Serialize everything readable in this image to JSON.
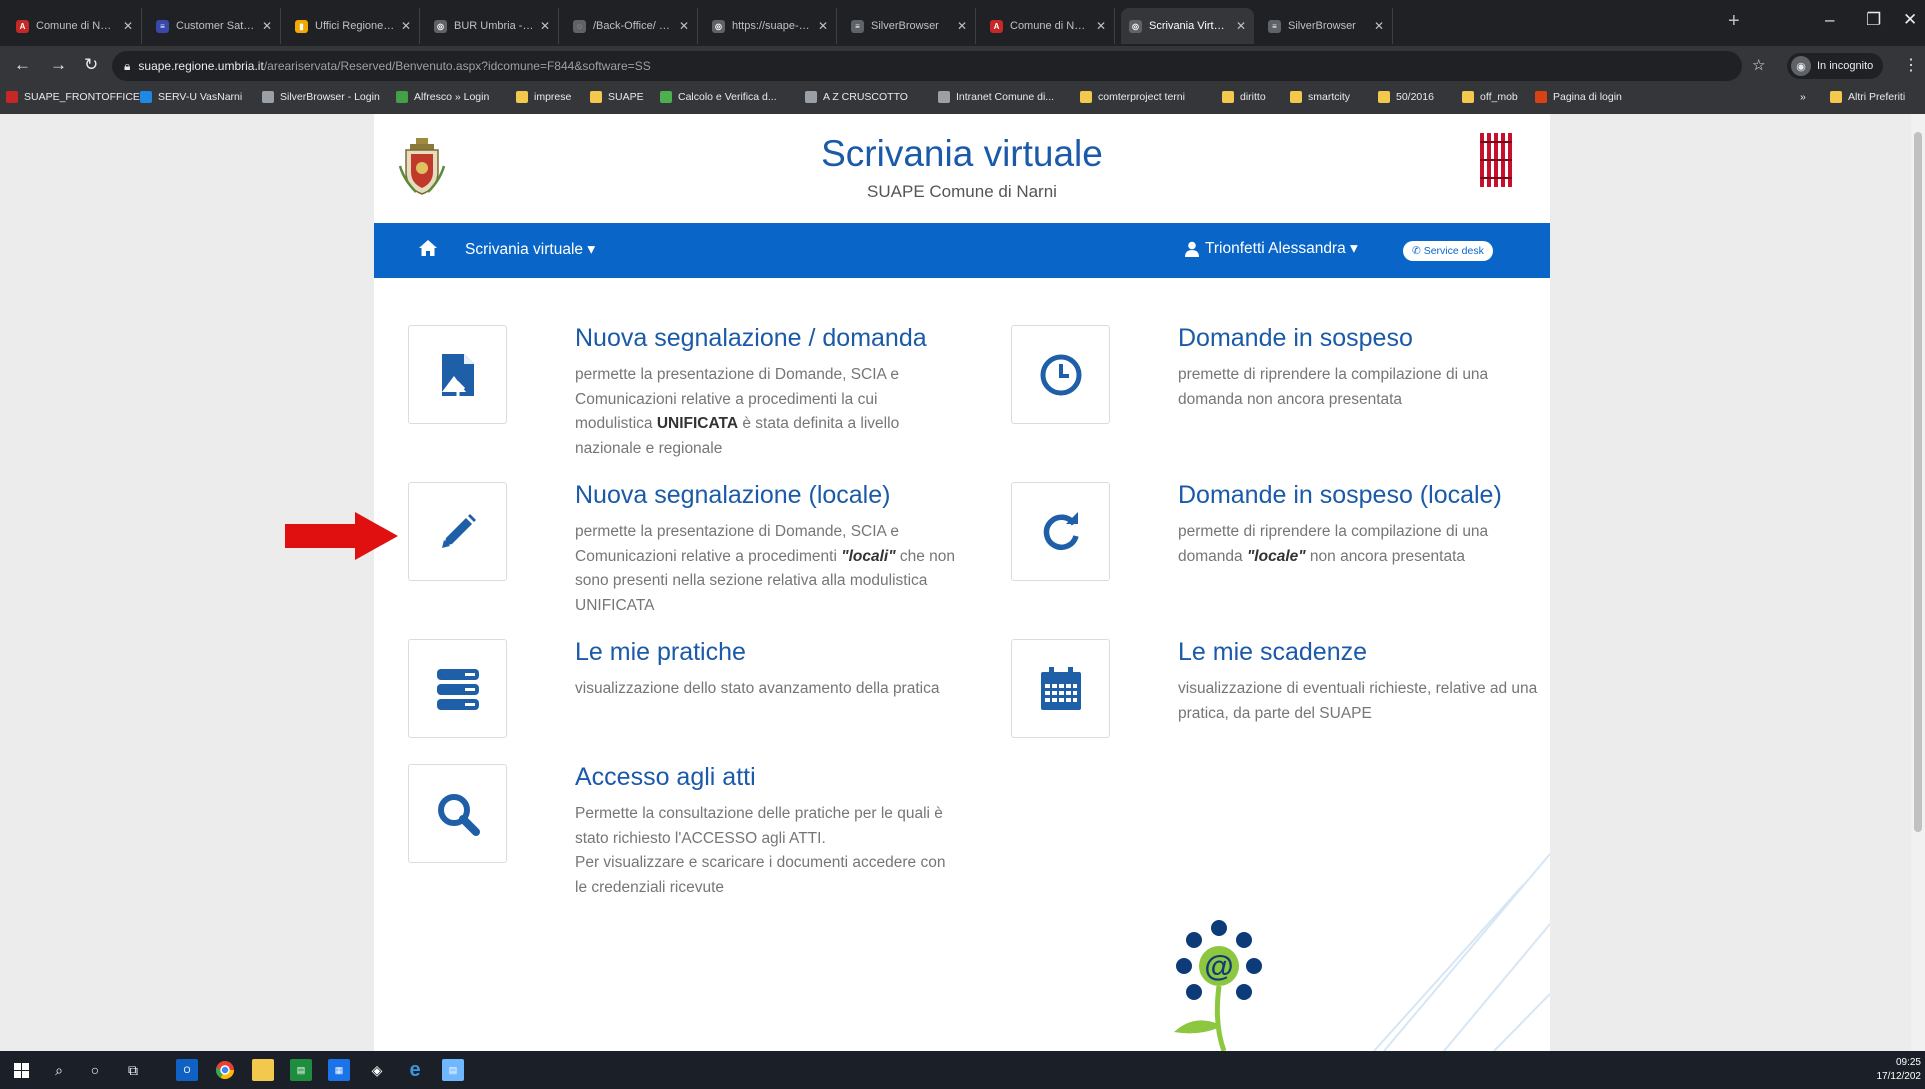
{
  "browser": {
    "tabs": [
      {
        "title": "Comune di Narni - ",
        "fav_color": "#c62828",
        "fav_glyph": "A"
      },
      {
        "title": "Customer Satisfacti",
        "fav_color": "#3949ab",
        "fav_glyph": "≡"
      },
      {
        "title": "Uffici Regione Umbr",
        "fav_color": "#f2a900",
        "fav_glyph": "▮"
      },
      {
        "title": "BUR Umbria - Serie",
        "fav_color": "#5f6368",
        "fav_glyph": "◎"
      },
      {
        "title": "/Back-Office/ - Det",
        "fav_color": "#5f6368",
        "fav_glyph": "◌"
      },
      {
        "title": "https://suape-bo.re",
        "fav_color": "#5f6368",
        "fav_glyph": "◎"
      },
      {
        "title": "SilverBrowser",
        "fav_color": "#5f6368",
        "fav_glyph": "≡"
      },
      {
        "title": "Comune di Narni - ",
        "fav_color": "#c62828",
        "fav_glyph": "A"
      },
      {
        "title": "Scrivania Virtuale",
        "fav_color": "#5f6368",
        "fav_glyph": "◎",
        "active": true
      },
      {
        "title": "SilverBrowser",
        "fav_color": "#5f6368",
        "fav_glyph": "≡"
      }
    ],
    "url_host": "suape.regione.umbria.it",
    "url_path": "/areariservata/Reserved/Benvenuto.aspx?idcomune=F844&software=SS",
    "incognito_label": "In incognito",
    "bookmarks": [
      {
        "label": "SUAPE_FRONTOFFICE",
        "color": "#c62828"
      },
      {
        "label": "SERV-U VasNarni",
        "color": "#1e88e5"
      },
      {
        "label": "SilverBrowser - Login",
        "color": "#9aa0a6"
      },
      {
        "label": "Alfresco » Login",
        "color": "#43a047"
      },
      {
        "label": "imprese",
        "color": "#f2c94c"
      },
      {
        "label": "SUAPE",
        "color": "#f2c94c"
      },
      {
        "label": "Calcolo e Verifica d...",
        "color": "#4caf50"
      },
      {
        "label": "A Z CRUSCOTTO",
        "color": "#9aa0a6"
      },
      {
        "label": "Intranet Comune di...",
        "color": "#9aa0a6"
      },
      {
        "label": "comterproject terni",
        "color": "#f2c94c"
      },
      {
        "label": "diritto",
        "color": "#f2c94c"
      },
      {
        "label": "smartcity",
        "color": "#f2c94c"
      },
      {
        "label": "50/2016",
        "color": "#f2c94c"
      },
      {
        "label": "off_mob",
        "color": "#f2c94c"
      },
      {
        "label": "Pagina di login",
        "color": "#d84315"
      }
    ],
    "bookmarks_more": "»",
    "other_bookmarks": "Altri Preferiti"
  },
  "page": {
    "title": "Scrivania virtuale",
    "subtitle": "SUAPE Comune di Narni",
    "nav": {
      "menu_label": "Scrivania virtuale ▾",
      "user_label": "Trionfetti Alessandra ▾",
      "service_desk": "Service desk"
    },
    "items": [
      {
        "title": "Nuova segnalazione / domanda",
        "desc": "permette la presentazione di Domande, SCIA e Comunicazioni relative a procedimenti la cui modulistica <b>UNIFICATA</b> è stata definita a livello nazionale e regionale",
        "icon": "upload-file-icon"
      },
      {
        "title": "Domande in sospeso",
        "desc": "premette di riprendere la compilazione di una domanda non ancora presentata",
        "icon": "clock-icon"
      },
      {
        "title": "Nuova segnalazione (locale)",
        "desc": "permette la presentazione di Domande, SCIA e Comunicazioni relative a procedimenti <i>\"locali\"</i> che non sono presenti nella sezione relativa alla modulistica UNIFICATA",
        "icon": "pencil-icon"
      },
      {
        "title": "Domande in sospeso (locale)",
        "desc": "permette di riprendere la compilazione di una domanda <i>\"locale\"</i> non ancora presentata",
        "icon": "refresh-icon"
      },
      {
        "title": "Le mie pratiche",
        "desc": "visualizzazione dello stato avanzamento della pratica",
        "icon": "server-icon"
      },
      {
        "title": "Le mie scadenze",
        "desc": "visualizzazione di eventuali richieste, relative ad una pratica, da parte del SUAPE",
        "icon": "calendar-icon"
      },
      {
        "title": "Accesso agli atti",
        "desc": "Permette la consultazione delle pratiche per le quali è stato richiesto l'ACCESSO agli ATTI.<br>Per visualizzare e scaricare i documenti accedere con le credenziali ricevute",
        "icon": "search-icon"
      }
    ]
  },
  "taskbar": {
    "time": "09:25",
    "date": "17/12/202"
  },
  "colors": {
    "brand_blue": "#0966c8",
    "title_blue": "#1a5aa8",
    "annotation_arrow": "#e01010"
  }
}
